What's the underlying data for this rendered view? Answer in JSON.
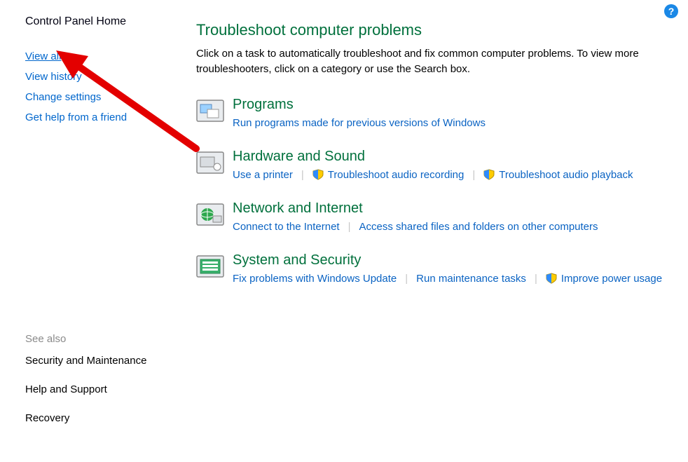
{
  "sidebar": {
    "heading": "Control Panel Home",
    "links": [
      {
        "label": "View all",
        "underlined": true
      },
      {
        "label": "View history",
        "underlined": false
      },
      {
        "label": "Change settings",
        "underlined": false
      },
      {
        "label": "Get help from a friend",
        "underlined": false
      }
    ],
    "see_also_heading": "See also",
    "see_also": [
      {
        "label": "Security and Maintenance"
      },
      {
        "label": "Help and Support"
      },
      {
        "label": "Recovery"
      }
    ]
  },
  "main": {
    "title": "Troubleshoot computer problems",
    "description": "Click on a task to automatically troubleshoot and fix common computer problems. To view more troubleshooters, click on a category or use the Search box.",
    "categories": [
      {
        "title": "Programs",
        "tasks": [
          {
            "label": "Run programs made for previous versions of Windows",
            "shield": false
          }
        ]
      },
      {
        "title": "Hardware and Sound",
        "tasks": [
          {
            "label": "Use a printer",
            "shield": false
          },
          {
            "label": "Troubleshoot audio recording",
            "shield": true
          },
          {
            "label": "Troubleshoot audio playback",
            "shield": true
          }
        ]
      },
      {
        "title": "Network and Internet",
        "tasks": [
          {
            "label": "Connect to the Internet",
            "shield": false
          },
          {
            "label": "Access shared files and folders on other computers",
            "shield": false
          }
        ]
      },
      {
        "title": "System and Security",
        "tasks": [
          {
            "label": "Fix problems with Windows Update",
            "shield": false
          },
          {
            "label": "Run maintenance tasks",
            "shield": false
          },
          {
            "label": "Improve power usage",
            "shield": true
          }
        ]
      }
    ]
  },
  "help_tooltip": "?"
}
